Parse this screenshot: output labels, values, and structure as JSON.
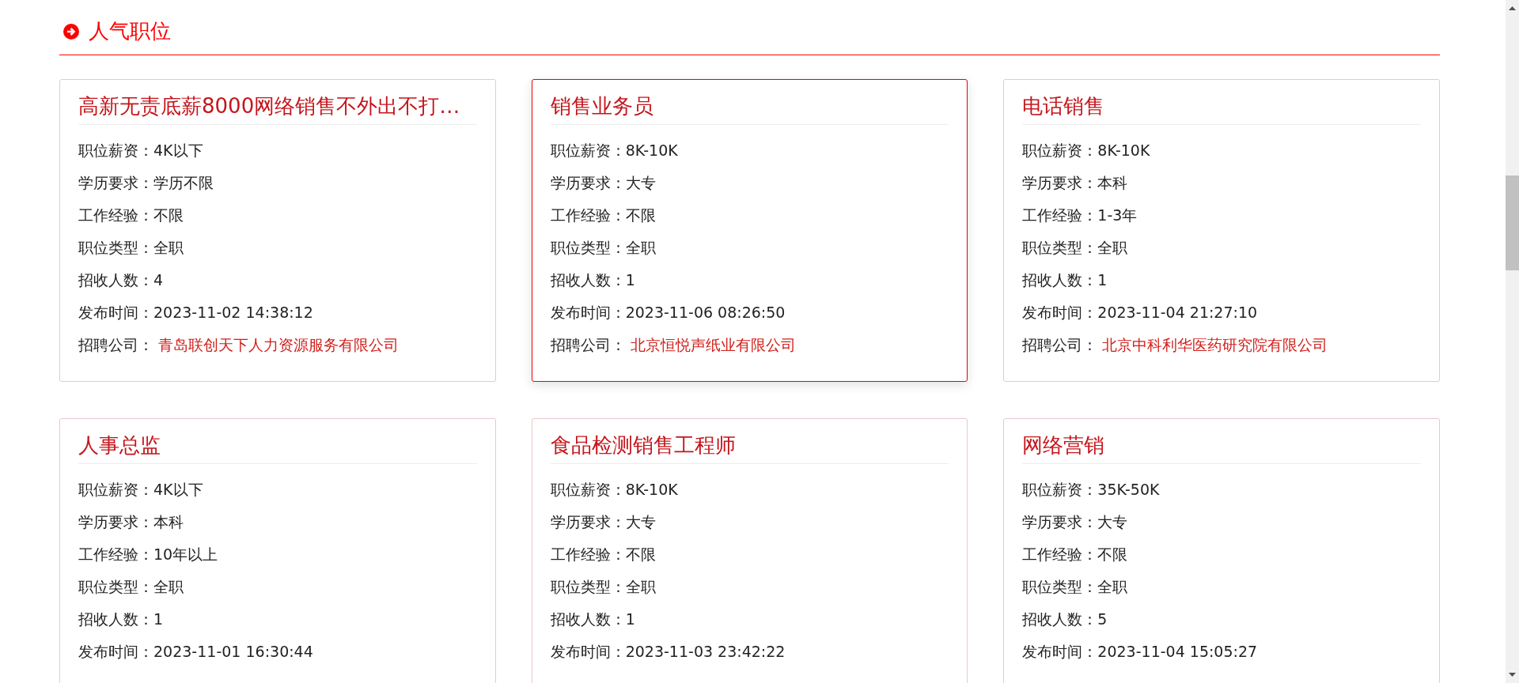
{
  "section": {
    "title": "人气职位"
  },
  "jobs": [
    {
      "title": "高新无责底薪8000网络销售不外出不打…",
      "selected": false,
      "fields": [
        {
          "label": "职位薪资：",
          "value": "4K以下"
        },
        {
          "label": "学历要求：",
          "value": "学历不限"
        },
        {
          "label": "工作经验：",
          "value": "不限"
        },
        {
          "label": "职位类型：",
          "value": "全职"
        },
        {
          "label": "招收人数：",
          "value": "4"
        },
        {
          "label": "发布时间：",
          "value": "2023-11-02 14:38:12"
        }
      ],
      "company_label": "招聘公司：",
      "company": "青岛联创天下人力资源服务有限公司"
    },
    {
      "title": "销售业务员",
      "selected": true,
      "fields": [
        {
          "label": "职位薪资：",
          "value": "8K-10K"
        },
        {
          "label": "学历要求：",
          "value": "大专"
        },
        {
          "label": "工作经验：",
          "value": "不限"
        },
        {
          "label": "职位类型：",
          "value": "全职"
        },
        {
          "label": "招收人数：",
          "value": "1"
        },
        {
          "label": "发布时间：",
          "value": "2023-11-06 08:26:50"
        }
      ],
      "company_label": "招聘公司：",
      "company": "北京恒悦声纸业有限公司"
    },
    {
      "title": "电话销售",
      "selected": false,
      "fields": [
        {
          "label": "职位薪资：",
          "value": "8K-10K"
        },
        {
          "label": "学历要求：",
          "value": "本科"
        },
        {
          "label": "工作经验：",
          "value": "1-3年"
        },
        {
          "label": "职位类型：",
          "value": "全职"
        },
        {
          "label": "招收人数：",
          "value": "1"
        },
        {
          "label": "发布时间：",
          "value": "2023-11-04 21:27:10"
        }
      ],
      "company_label": "招聘公司：",
      "company": "北京中科利华医药研究院有限公司"
    },
    {
      "title": "人事总监",
      "selected": false,
      "fields": [
        {
          "label": "职位薪资：",
          "value": "4K以下"
        },
        {
          "label": "学历要求：",
          "value": "本科"
        },
        {
          "label": "工作经验：",
          "value": "10年以上"
        },
        {
          "label": "职位类型：",
          "value": "全职"
        },
        {
          "label": "招收人数：",
          "value": "1"
        },
        {
          "label": "发布时间：",
          "value": "2023-11-01 16:30:44"
        }
      ]
    },
    {
      "title": "食品检测销售工程师",
      "selected": false,
      "fields": [
        {
          "label": "职位薪资：",
          "value": "8K-10K"
        },
        {
          "label": "学历要求：",
          "value": "大专"
        },
        {
          "label": "工作经验：",
          "value": "不限"
        },
        {
          "label": "职位类型：",
          "value": "全职"
        },
        {
          "label": "招收人数：",
          "value": "1"
        },
        {
          "label": "发布时间：",
          "value": "2023-11-03 23:42:22"
        }
      ]
    },
    {
      "title": "网络营销",
      "selected": false,
      "fields": [
        {
          "label": "职位薪资：",
          "value": "35K-50K"
        },
        {
          "label": "学历要求：",
          "value": "大专"
        },
        {
          "label": "工作经验：",
          "value": "不限"
        },
        {
          "label": "职位类型：",
          "value": "全职"
        },
        {
          "label": "招收人数：",
          "value": "5"
        },
        {
          "label": "发布时间：",
          "value": "2023-11-04 15:05:27"
        }
      ]
    }
  ]
}
